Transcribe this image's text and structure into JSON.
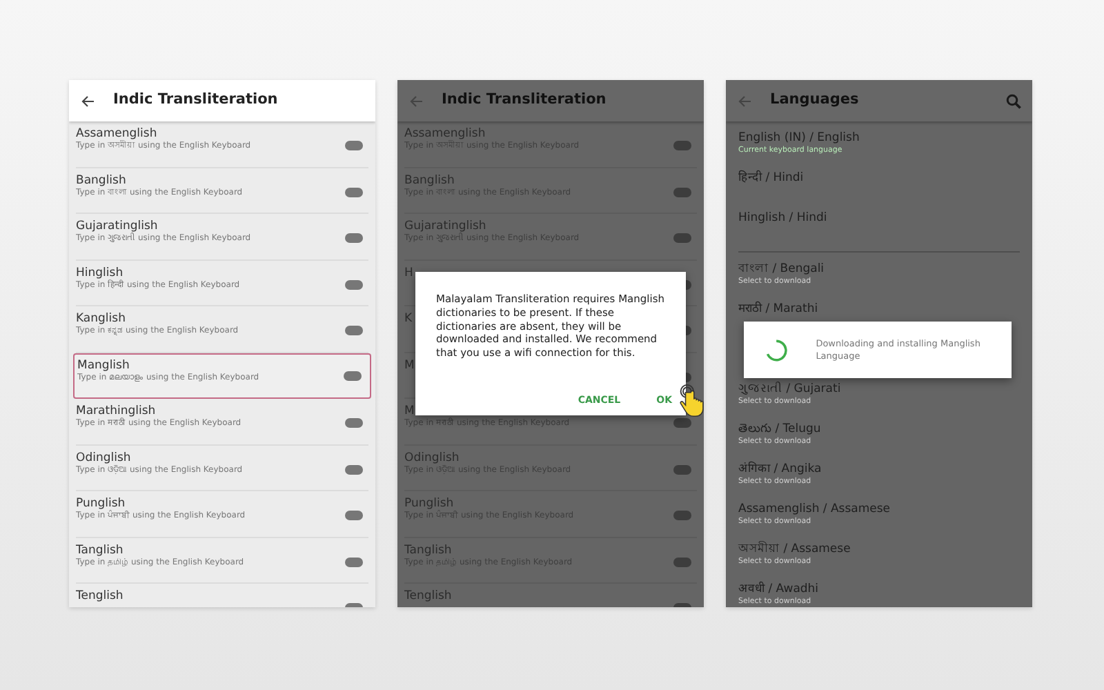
{
  "screens": [
    {
      "kind": "toggles",
      "dimmed": false,
      "title": "Indic Transliteration",
      "items": [
        {
          "title": "Assamenglish",
          "subtitle": "Type in অসমীয়া using the English Keyboard",
          "on": false,
          "selected": false
        },
        {
          "title": "Banglish",
          "subtitle": "Type in বাংলা using the English Keyboard",
          "on": false,
          "selected": false
        },
        {
          "title": "Gujaratinglish",
          "subtitle": "Type in ગુજરાતી using the English Keyboard",
          "on": false,
          "selected": false
        },
        {
          "title": "Hinglish",
          "subtitle": "Type in हिन्दी using the English Keyboard",
          "on": false,
          "selected": false
        },
        {
          "title": "Kanglish",
          "subtitle": "Type in ಕನ್ನಡ using the English Keyboard",
          "on": false,
          "selected": false
        },
        {
          "title": "Manglish",
          "subtitle": "Type in മലയാളം using the English Keyboard",
          "on": false,
          "selected": true
        },
        {
          "title": "Marathinglish",
          "subtitle": "Type in मराठी using the English Keyboard",
          "on": false,
          "selected": false
        },
        {
          "title": "Odinglish",
          "subtitle": "Type in ଓଡ଼ିଆ using the English Keyboard",
          "on": false,
          "selected": false
        },
        {
          "title": "Punglish",
          "subtitle": "Type in ਪੰਜਾਬੀ using the English Keyboard",
          "on": false,
          "selected": false
        },
        {
          "title": "Tanglish",
          "subtitle": "Type in தமிழ் using the English Keyboard",
          "on": false,
          "selected": false
        },
        {
          "title": "Tenglish",
          "on": false,
          "selected": false
        }
      ]
    },
    {
      "kind": "toggles",
      "dimmed": true,
      "title": "Indic Transliteration",
      "items": [
        {
          "title": "Assamenglish",
          "subtitle": "Type in অসমীয়া using the English Keyboard",
          "on": false,
          "selected": false
        },
        {
          "title": "Banglish",
          "subtitle": "Type in বাংলা using the English Keyboard",
          "on": false,
          "selected": false
        },
        {
          "title": "Gujaratinglish",
          "subtitle": "Type in ગુજરાતી using the English Keyboard",
          "on": false,
          "selected": false
        },
        {
          "title": "H",
          "on": false,
          "selected": false
        },
        {
          "title": "K",
          "on": false,
          "selected": false
        },
        {
          "title": "M",
          "on": false,
          "selected": false
        },
        {
          "title": "M",
          "subtitle": "Type in मराठी using the English Keyboard",
          "on": false,
          "selected": false
        },
        {
          "title": "Odinglish",
          "subtitle": "Type in ଓଡ଼ିଆ using the English Keyboard",
          "on": false,
          "selected": false
        },
        {
          "title": "Punglish",
          "subtitle": "Type in ਪੰਜਾਬੀ using the English Keyboard",
          "on": false,
          "selected": false
        },
        {
          "title": "Tanglish",
          "subtitle": "Type in தமிழ் using the English Keyboard",
          "on": false,
          "selected": false
        },
        {
          "title": "Tenglish",
          "on": false,
          "selected": false
        }
      ],
      "dialog": {
        "message": "Malayalam Transliteration requires Manglish dictionaries to be present. If these dictionaries are absent, they will be downloaded and installed. We recommend that you use a wifi connection for this.",
        "buttons": [
          "CANCEL",
          "OK"
        ]
      }
    },
    {
      "kind": "languages",
      "dimmed": true,
      "title": "Languages",
      "items": [
        {
          "kind": "language",
          "title": "English (IN) / English",
          "subtitle": "Current keyboard language",
          "current": true,
          "divider_after": false
        },
        {
          "kind": "language",
          "title": "हिन्दी / Hindi",
          "divider_after": false
        },
        {
          "kind": "language",
          "title": "Hinglish / Hindi",
          "divider_after": true
        },
        {
          "kind": "language",
          "title": "বাংলা / Bengali",
          "subtitle": "Select to download",
          "current": false,
          "divider_after": false
        },
        {
          "kind": "language",
          "title": "मराठी / Marathi",
          "divider_after": false
        },
        {
          "kind": "progress",
          "message": "Downloading and installing Manglish Language"
        },
        {
          "kind": "language",
          "title": "ગુજરાતી / Gujarati",
          "subtitle": "Select to download",
          "current": false,
          "divider_after": false
        },
        {
          "kind": "language",
          "title": "తెలుగు / Telugu",
          "subtitle": "Select to download",
          "current": false,
          "divider_after": false
        },
        {
          "kind": "language",
          "title": "अंगिका / Angika",
          "subtitle": "Select to download",
          "current": false,
          "divider_after": false
        },
        {
          "kind": "language",
          "title": "Assamenglish / Assamese",
          "subtitle": "Select to download",
          "current": false,
          "divider_after": false
        },
        {
          "kind": "language",
          "title": "অসমীয়া / Assamese",
          "subtitle": "Select to download",
          "current": false,
          "divider_after": false
        },
        {
          "kind": "language",
          "title": "अवधी / Awadhi",
          "subtitle": "Select to download",
          "current": false,
          "divider_after": false
        }
      ]
    }
  ]
}
